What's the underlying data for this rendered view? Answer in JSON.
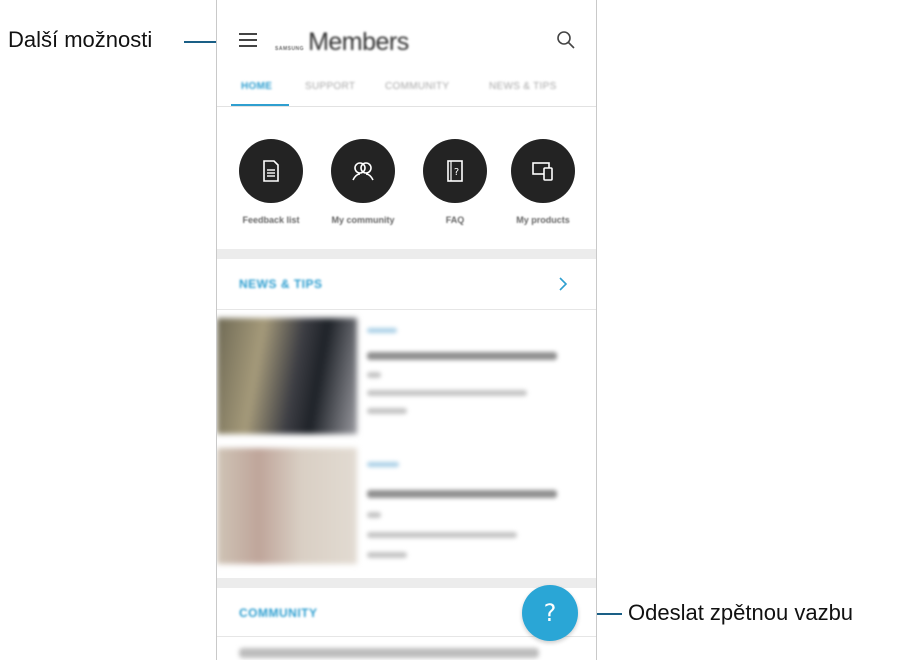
{
  "annotations": {
    "more_options": "Další možnosti",
    "send_feedback": "Odeslat zpětnou vazbu"
  },
  "app": {
    "brand_small": "SAMSUNG",
    "brand_name": "Members"
  },
  "tabs": [
    {
      "label": "HOME",
      "active": true
    },
    {
      "label": "SUPPORT",
      "active": false
    },
    {
      "label": "COMMUNITY",
      "active": false
    },
    {
      "label": "NEWS & TIPS",
      "active": false
    }
  ],
  "shortcuts": [
    {
      "label": "Feedback list",
      "icon": "document-icon"
    },
    {
      "label": "My community",
      "icon": "people-icon"
    },
    {
      "label": "FAQ",
      "icon": "faq-book-icon"
    },
    {
      "label": "My products",
      "icon": "devices-icon"
    }
  ],
  "sections": {
    "news_tips": "NEWS & TIPS",
    "community": "COMMUNITY"
  },
  "fab": {
    "symbol": "?",
    "icon": "question-icon",
    "color": "#2aa6d6"
  },
  "colors": {
    "accent": "#2f9fd0",
    "callout_line": "#1a5f86"
  }
}
